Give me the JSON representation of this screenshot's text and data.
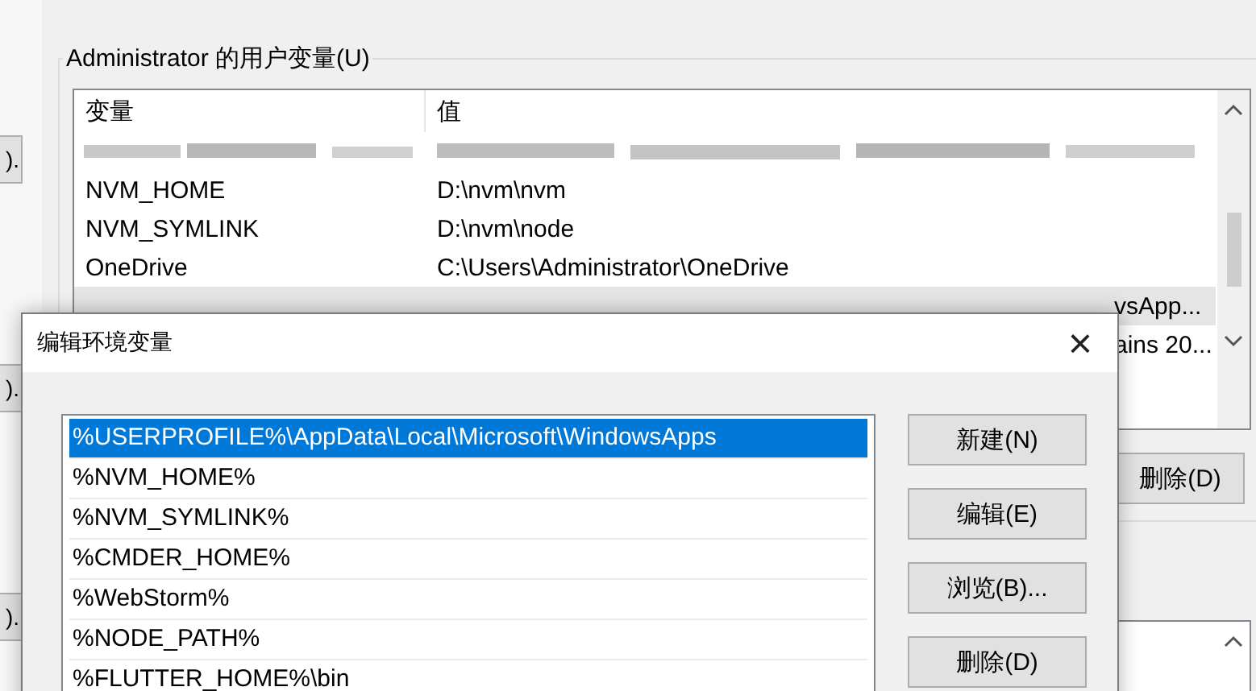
{
  "back_window": {
    "button_labels": [
      ").",
      ").",
      ")."
    ]
  },
  "env_window": {
    "group_title": "Administrator 的用户变量(U)",
    "table": {
      "columns": [
        "变量",
        "值"
      ],
      "rows": [
        {
          "kind": "blurred"
        },
        {
          "kind": "text",
          "cells": [
            "NVM_HOME",
            "D:\\nvm\\nvm"
          ],
          "selected": false
        },
        {
          "kind": "text",
          "cells": [
            "NVM_SYMLINK",
            "D:\\nvm\\node"
          ],
          "selected": false
        },
        {
          "kind": "text",
          "cells": [
            "OneDrive",
            "C:\\Users\\Administrator\\OneDrive"
          ],
          "selected": false
        },
        {
          "kind": "covered",
          "tail": "vsApp...",
          "selected": true
        },
        {
          "kind": "covered",
          "tail": "ains 20...",
          "selected": false
        }
      ]
    },
    "delete_button": "删除(D)"
  },
  "dialog": {
    "title": "编辑环境变量",
    "close": "×",
    "items": [
      {
        "label": "%USERPROFILE%\\AppData\\Local\\Microsoft\\WindowsApps",
        "selected": true
      },
      {
        "label": "%NVM_HOME%",
        "selected": false
      },
      {
        "label": "%NVM_SYMLINK%",
        "selected": false
      },
      {
        "label": "%CMDER_HOME%",
        "selected": false
      },
      {
        "label": "%WebStorm%",
        "selected": false
      },
      {
        "label": "%NODE_PATH%",
        "selected": false
      },
      {
        "label": "%FLUTTER_HOME%\\bin",
        "selected": false
      }
    ],
    "buttons": [
      "新建(N)",
      "编辑(E)",
      "浏览(B)...",
      "删除(D)"
    ]
  }
}
